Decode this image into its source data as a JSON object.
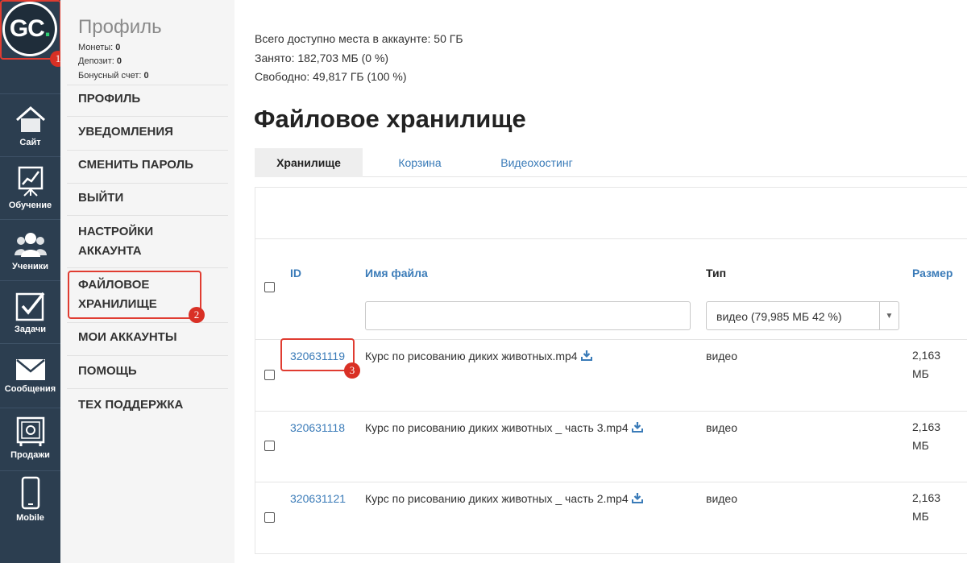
{
  "rail": {
    "logo_text": "GC",
    "logo_dot": ".",
    "items": [
      {
        "label": "Сайт",
        "icon": "home-icon"
      },
      {
        "label": "Обучение",
        "icon": "chart-board-icon"
      },
      {
        "label": "Ученики",
        "icon": "users-icon"
      },
      {
        "label": "Задачи",
        "icon": "checkbox-icon"
      },
      {
        "label": "Сообщения",
        "icon": "envelope-icon"
      },
      {
        "label": "Продажи",
        "icon": "safe-icon"
      },
      {
        "label": "Mobile",
        "icon": "phone-icon"
      }
    ]
  },
  "profile": {
    "title": "Профиль",
    "coins_label": "Монеты:",
    "coins_value": "0",
    "deposit_label": "Депозит:",
    "deposit_value": "0",
    "bonus_label": "Бонусный счет:",
    "bonus_value": "0"
  },
  "menu": {
    "items": [
      "ПРОФИЛЬ",
      "УВЕДОМЛЕНИЯ",
      "СМЕНИТЬ ПАРОЛЬ",
      "ВЫЙТИ",
      "НАСТРОЙКИ",
      "АККАУНТА",
      "ФАЙЛОВОЕ",
      "ХРАНИЛИЩЕ",
      "МОИ АККАУНТЫ",
      "ПОМОЩЬ",
      "ТЕХ ПОДДЕРЖКА"
    ]
  },
  "annotations": [
    "1",
    "2",
    "3"
  ],
  "storage": {
    "total": "Всего доступно места в аккаунте: 50 ГБ",
    "used": "Занято: 182,703 МБ (0 %)",
    "free": "Свободно: 49,817 ГБ (100 %)"
  },
  "page_title": "Файловое хранилище",
  "tabs": [
    "Хранилище",
    "Корзина",
    "Видеохостинг"
  ],
  "table": {
    "headers": {
      "id": "ID",
      "name": "Имя файла",
      "type": "Тип",
      "size": "Размер"
    },
    "filter_type_value": "видео (79,985 МБ 42 %)",
    "filter_name_value": "",
    "rows": [
      {
        "id": "320631119",
        "name": "Курс по рисованию диких животных.mp4",
        "type": "видео",
        "size_num": "2,163",
        "size_unit": "МБ"
      },
      {
        "id": "320631118",
        "name": "Курс по рисованию диких животных _ часть 3.mp4",
        "type": "видео",
        "size_num": "2,163",
        "size_unit": "МБ"
      },
      {
        "id": "320631121",
        "name": "Курс по рисованию диких животных _ часть 2.mp4",
        "type": "видео",
        "size_num": "2,163",
        "size_unit": "МБ"
      }
    ]
  },
  "colors": {
    "rail_bg": "#2c3e50",
    "link": "#3a7bb8",
    "annotation": "#d93025",
    "logo_accent": "#2ecc71"
  }
}
